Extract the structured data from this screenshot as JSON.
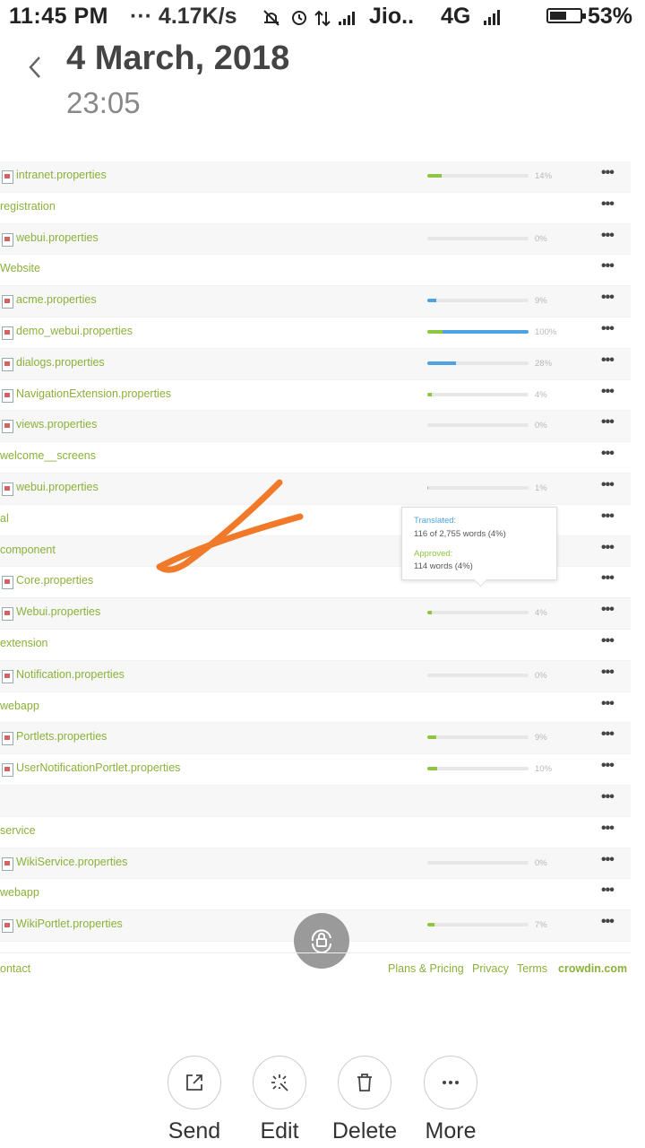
{
  "status_bar": {
    "time": "11:45 PM",
    "speed": "··· 4.17K/s",
    "carrier": "Jio..",
    "network": "4G",
    "battery": "53%"
  },
  "header": {
    "date": "4 March, 2018",
    "time": "23:05"
  },
  "rows": [
    {
      "name": "intranet.properties",
      "type": "file",
      "green": 0.14,
      "blue": 0,
      "pct": "14%"
    },
    {
      "name": "registration",
      "type": "folder"
    },
    {
      "name": "webui.properties",
      "type": "file",
      "green": 0,
      "blue": 0,
      "pct": "0%"
    },
    {
      "name": "Website",
      "type": "folder"
    },
    {
      "name": "acme.properties",
      "type": "file",
      "green": 0,
      "blue": 0.09,
      "pct": "9%"
    },
    {
      "name": "demo_webui.properties",
      "type": "file",
      "green": 0.15,
      "blue": 0.85,
      "pct": "100%"
    },
    {
      "name": "dialogs.properties",
      "type": "file",
      "green": 0,
      "blue": 0.28,
      "pct": "28%"
    },
    {
      "name": "NavigationExtension.properties",
      "type": "file",
      "green": 0.04,
      "blue": 0,
      "pct": "4%"
    },
    {
      "name": "views.properties",
      "type": "file",
      "green": 0,
      "blue": 0,
      "pct": "0%"
    },
    {
      "name": "welcome__screens",
      "type": "folder"
    },
    {
      "name": "webui.properties",
      "type": "file",
      "green": 0.01,
      "blue": 0,
      "pct": "1%"
    },
    {
      "name": "al",
      "type": "folder"
    },
    {
      "name": "component",
      "type": "folder"
    },
    {
      "name": "Core.properties",
      "type": "file",
      "hidden": true
    },
    {
      "name": "Webui.properties",
      "type": "file",
      "green": 0.04,
      "blue": 0,
      "pct": "4%"
    },
    {
      "name": "extension",
      "type": "folder"
    },
    {
      "name": "Notification.properties",
      "type": "file",
      "green": 0,
      "blue": 0,
      "pct": "0%"
    },
    {
      "name": "webapp",
      "type": "folder"
    },
    {
      "name": "Portlets.properties",
      "type": "file",
      "green": 0.09,
      "blue": 0,
      "pct": "9%"
    },
    {
      "name": "UserNotificationPortlet.properties",
      "type": "file",
      "green": 0.1,
      "blue": 0,
      "pct": "10%"
    },
    {
      "name": "",
      "type": "folder"
    },
    {
      "name": "service",
      "type": "folder"
    },
    {
      "name": "WikiService.properties",
      "type": "file",
      "green": 0,
      "blue": 0,
      "pct": "0%"
    },
    {
      "name": "webapp",
      "type": "folder"
    },
    {
      "name": "WikiPortlet.properties",
      "type": "file",
      "green": 0.07,
      "blue": 0,
      "pct": "7%"
    }
  ],
  "tooltip": {
    "translated_label": "Translated:",
    "translated_value": "116 of 2,755 words (4%)",
    "approved_label": "Approved:",
    "approved_value": "114 words (4%)"
  },
  "footer": {
    "contact": "ontact",
    "plans": "Plans & Pricing",
    "privacy": "Privacy",
    "terms": "Terms",
    "brand": "crowdin.com"
  },
  "actions": [
    {
      "label": "Send",
      "icon": "share-icon"
    },
    {
      "label": "Edit",
      "icon": "magic-wand-icon"
    },
    {
      "label": "Delete",
      "icon": "trash-icon"
    },
    {
      "label": "More",
      "icon": "more-icon"
    }
  ],
  "menu_glyph": "•••"
}
